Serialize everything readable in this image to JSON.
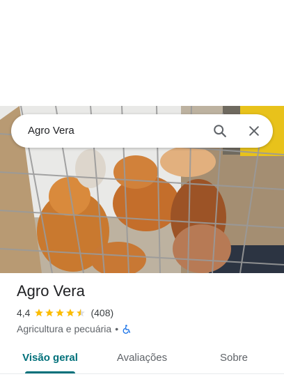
{
  "search": {
    "query": "Agro Vera"
  },
  "place": {
    "name": "Agro Vera",
    "rating": "4,4",
    "review_count": "(408)",
    "stars": 4.4,
    "category": "Agricultura e pecuária",
    "separator": "•"
  },
  "tabs": [
    {
      "label": "Visão geral",
      "active": true
    },
    {
      "label": "Avaliações",
      "active": false
    },
    {
      "label": "Sobre",
      "active": false
    }
  ],
  "colors": {
    "accent": "#00707a",
    "star": "#fbbc04",
    "accessibility": "#1a73e8"
  },
  "icons": {
    "search": "search-icon",
    "close": "close-icon",
    "accessibility": "wheelchair-icon"
  }
}
